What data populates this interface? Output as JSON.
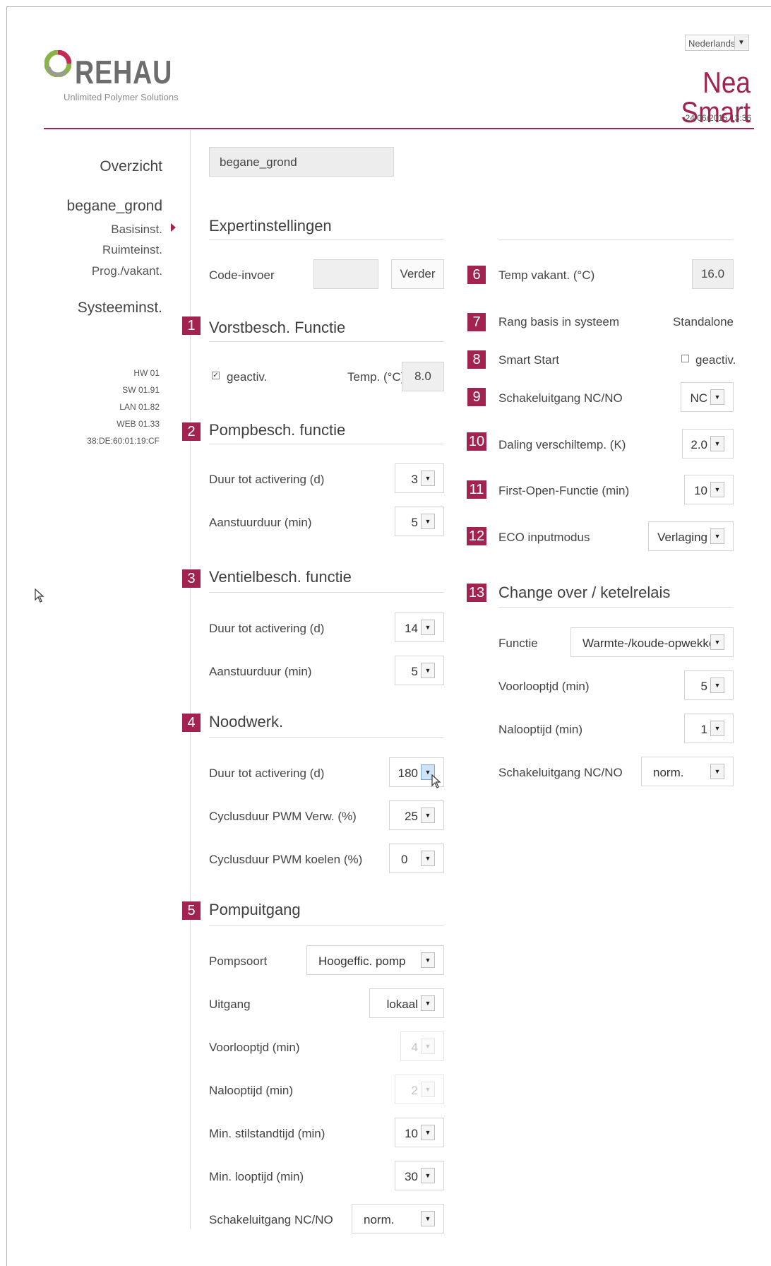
{
  "header": {
    "logo_text": "REHAU",
    "logo_sub": "Unlimited Polymer Solutions",
    "language": "Nederlands",
    "brand": "Nea Smart",
    "datetime": "24/06/2015 13:36"
  },
  "sidebar": {
    "overview": "Overzicht",
    "room": "begane_grond",
    "items": [
      "Basisinst.",
      "Ruimteinst.",
      "Prog./vakant."
    ],
    "system": "Systeeminst.",
    "versions": [
      "HW 01",
      "SW 01.91",
      "LAN 01.82",
      "WEB 01.33",
      "38:DE:60:01:19:CF"
    ]
  },
  "main": {
    "room_field": "begane_grond",
    "expert_title": "Expertinstellingen",
    "code_label": "Code-invoer",
    "code_value": "",
    "next_button": "Verder",
    "s1": {
      "num": "1",
      "title": "Vorstbesch. Functie",
      "active_label": "geactiv.",
      "active_checked": "✓",
      "temp_label": "Temp. (°C)",
      "temp_value": "8.0"
    },
    "s2": {
      "num": "2",
      "title": "Pompbesch. functie",
      "duur_label": "Duur tot activering (d)",
      "duur_value": "3",
      "aanst_label": "Aanstuurduur (min)",
      "aanst_value": "5"
    },
    "s3": {
      "num": "3",
      "title": "Ventielbesch. functie",
      "duur_label": "Duur tot activering (d)",
      "duur_value": "14",
      "aanst_label": "Aanstuurduur (min)",
      "aanst_value": "5"
    },
    "s4": {
      "num": "4",
      "title": "Noodwerk.",
      "duur_label": "Duur tot activering (d)",
      "duur_value": "180",
      "verw_label": "Cyclusduur PWM Verw. (%)",
      "verw_value": "25",
      "koel_label": "Cyclusduur PWM koelen (%)",
      "koel_value": "0"
    },
    "s5": {
      "num": "5",
      "title": "Pompuitgang",
      "soort_label": "Pompsoort",
      "soort_value": "Hoogeffic. pomp",
      "uitgang_label": "Uitgang",
      "uitgang_value": "lokaal",
      "voor_label": "Voorlooptjd (min)",
      "voor_value": "4",
      "na_label": "Nalooptijd (min)",
      "na_value": "2",
      "stil_label": "Min. stilstandtijd (min)",
      "stil_value": "10",
      "loop_label": "Min. looptijd (min)",
      "loop_value": "30",
      "nc_label": "Schakeluitgang NC/NO",
      "nc_value": "norm."
    }
  },
  "right": {
    "r6": {
      "num": "6",
      "label": "Temp vakant. (°C)",
      "value": "16.0"
    },
    "r7": {
      "num": "7",
      "label": "Rang basis in systeem",
      "value": "Standalone"
    },
    "r8": {
      "num": "8",
      "label": "Smart Start",
      "value": "geactiv."
    },
    "r9": {
      "num": "9",
      "label": "Schakeluitgang NC/NO",
      "value": "NC"
    },
    "r10": {
      "num": "10",
      "label": "Daling verschiltemp. (K)",
      "value": "2.0"
    },
    "r11": {
      "num": "11",
      "label": "First-Open-Functie (min)",
      "value": "10"
    },
    "r12": {
      "num": "12",
      "label": "ECO inputmodus",
      "value": "Verlaging"
    },
    "r13": {
      "num": "13",
      "title": "Change over / ketelrelais",
      "functie_label": "Functie",
      "functie_value": "Warmte-/koude-opwekker",
      "voor_label": "Voorlooptjd (min)",
      "voor_value": "5",
      "na_label": "Nalooptijd (min)",
      "na_value": "1",
      "nc_label": "Schakeluitgang NC/NO",
      "nc_value": "norm."
    }
  },
  "colors": {
    "accent": "#a2234f",
    "text": "#3a3a3a",
    "line": "#dcdcdc"
  },
  "icons": {
    "dropdown": "chevron-down-icon",
    "nav_active": "triangle-right-icon",
    "cursor": "mouse-pointer-icon"
  }
}
